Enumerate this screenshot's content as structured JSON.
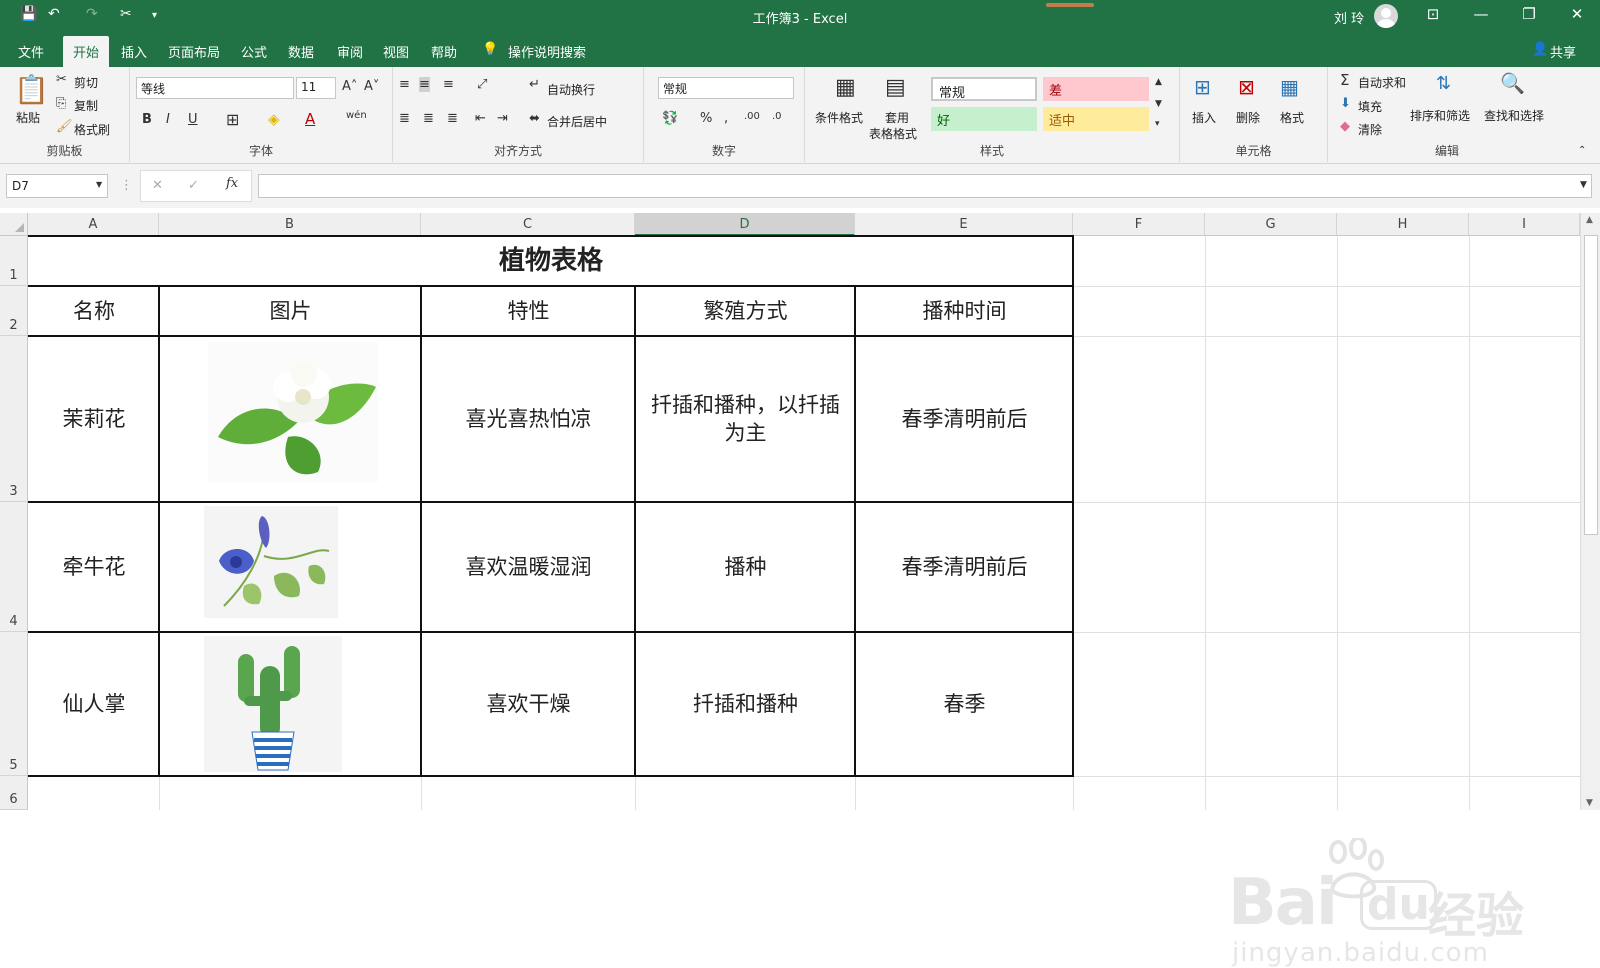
{
  "window": {
    "title": "工作簿3  -  Excel",
    "user": "刘 玲"
  },
  "tabs": [
    "文件",
    "开始",
    "插入",
    "页面布局",
    "公式",
    "数据",
    "审阅",
    "视图",
    "帮助"
  ],
  "tell_me": "操作说明搜索",
  "share": "共享",
  "ribbon": {
    "clipboard": {
      "label": "剪贴板",
      "paste": "粘贴",
      "cut": "剪切",
      "copy": "复制",
      "format_painter": "格式刷"
    },
    "font": {
      "label": "字体",
      "font_name": "等线",
      "font_size": "11",
      "wen": "wén"
    },
    "alignment": {
      "label": "对齐方式",
      "wrap": "自动换行",
      "merge": "合并后居中"
    },
    "number": {
      "label": "数字",
      "format": "常规"
    },
    "styles": {
      "label": "样式",
      "cond_format": "条件格式",
      "table_format_1": "套用",
      "table_format_2": "表格格式",
      "normal": "常规",
      "bad": "差",
      "good": "好",
      "neutral": "适中"
    },
    "cells": {
      "label": "单元格",
      "insert": "插入",
      "delete": "删除",
      "format": "格式"
    },
    "editing": {
      "label": "编辑",
      "autosum": "自动求和",
      "fill": "填充",
      "clear": "清除",
      "sort": "排序和筛选",
      "find": "查找和选择"
    }
  },
  "name_box": "D7",
  "columns": [
    "A",
    "B",
    "C",
    "D",
    "E",
    "F",
    "G",
    "H",
    "I"
  ],
  "rows": [
    "1",
    "2",
    "3",
    "4",
    "5",
    "6"
  ],
  "table": {
    "title": "植物表格",
    "headers": [
      "名称",
      "图片",
      "特性",
      "繁殖方式",
      "播种时间"
    ],
    "rows": [
      {
        "name": "茉莉花",
        "picture": "jasmine-flower",
        "trait": "喜光喜热怕凉",
        "propagation": "扦插和播种，以扦插为主",
        "sowing": "春季清明前后"
      },
      {
        "name": "牵牛花",
        "picture": "morning-glory",
        "trait": "喜欢温暖湿润",
        "propagation": "播种",
        "sowing": "春季清明前后"
      },
      {
        "name": "仙人掌",
        "picture": "potted-cactus",
        "trait": "喜欢干燥",
        "propagation": "扦插和播种",
        "sowing": "春季"
      }
    ]
  },
  "watermark": {
    "brand": "Bai",
    "brand2": "du",
    "cn": "经验",
    "url": "jingyan.baidu.com"
  },
  "colors": {
    "excel_green": "#217346",
    "bad_fill": "#ffc7ce",
    "good_fill": "#c6efce",
    "neutral_fill": "#ffeb9c"
  }
}
